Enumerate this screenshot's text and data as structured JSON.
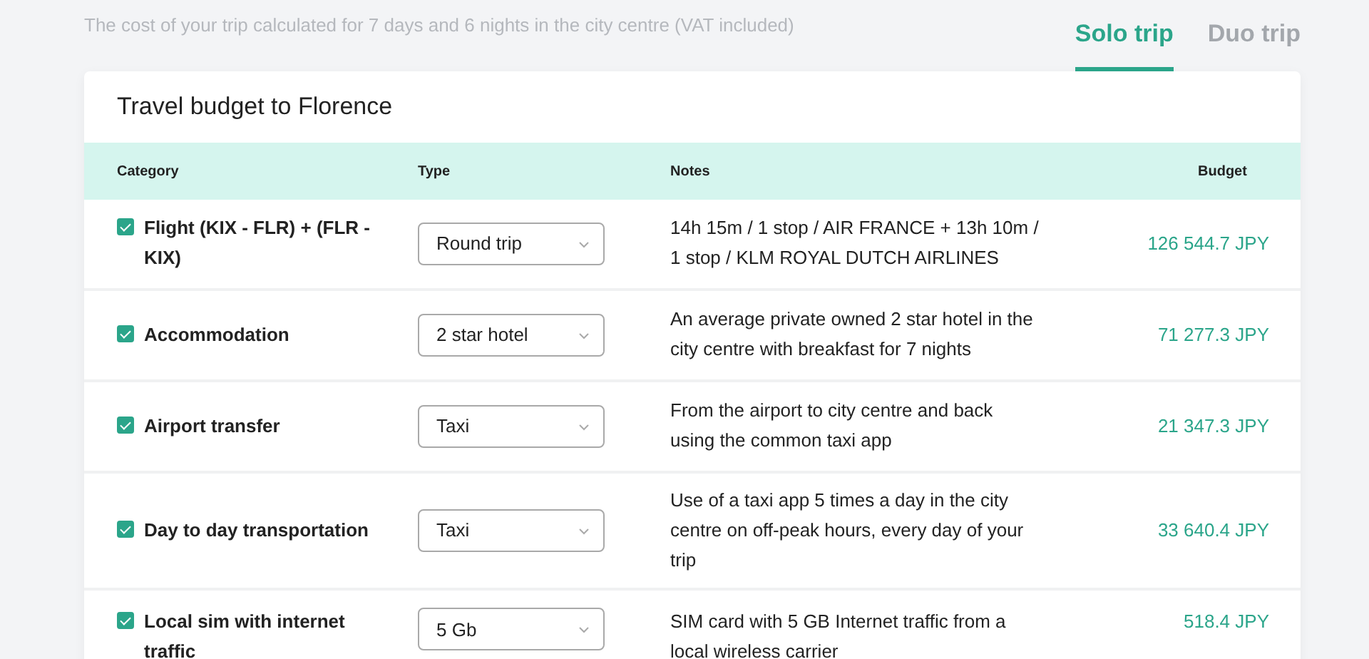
{
  "summary": "The cost of your trip calculated for 7 days and 6 nights in the city centre (VAT included)",
  "tabs": [
    {
      "label": "Solo trip",
      "selected": true
    },
    {
      "label": "Duo trip",
      "selected": false
    }
  ],
  "card": {
    "title": "Travel budget to Florence",
    "table": {
      "columns": [
        "Category",
        "Type",
        "Notes",
        "Budget"
      ],
      "rows": [
        {
          "checked": true,
          "category": "Flight (KIX - FLR) + (FLR - KIX)",
          "type": "Round trip",
          "notes": "14h 15m / 1 stop / AIR FRANCE + 13h 10m / 1 stop / KLM ROYAL DUTCH AIRLINES",
          "budget": "126 544.7 JPY"
        },
        {
          "checked": true,
          "category": "Accommodation",
          "type": "2 star hotel",
          "notes": "An average private owned 2 star hotel in the city centre with breakfast for 7 nights",
          "budget": "71 277.3 JPY"
        },
        {
          "checked": true,
          "category": "Airport transfer",
          "type": "Taxi",
          "notes": "From the airport to city centre and back using the common taxi app",
          "budget": "21 347.3 JPY"
        },
        {
          "checked": true,
          "category": "Day to day transportation",
          "type": "Taxi",
          "notes": "Use of a taxi app 5 times a day in the city centre on off-peak hours, every day of your trip",
          "budget": "33 640.4 JPY"
        },
        {
          "checked": true,
          "category": "Local sim with internet traffic",
          "type": "5 Gb",
          "notes": "SIM card with 5 GB Internet traffic from a local wireless carrier",
          "budget": "518.4 JPY"
        }
      ]
    }
  }
}
